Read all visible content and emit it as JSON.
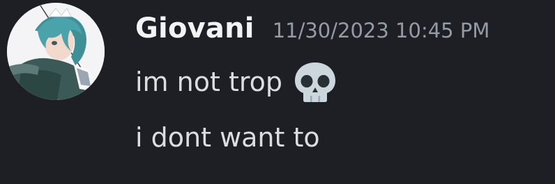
{
  "message": {
    "author": "Giovani",
    "timestamp": "11/30/2023 10:45 PM",
    "lines": [
      {
        "text": "im not trop",
        "emoji": "skull-emoji"
      },
      {
        "text": "i dont want to"
      }
    ]
  },
  "colors": {
    "background": "#1e1f24",
    "username": "#f2f3f5",
    "timestamp": "#949ba4",
    "text": "#dbdee1"
  }
}
